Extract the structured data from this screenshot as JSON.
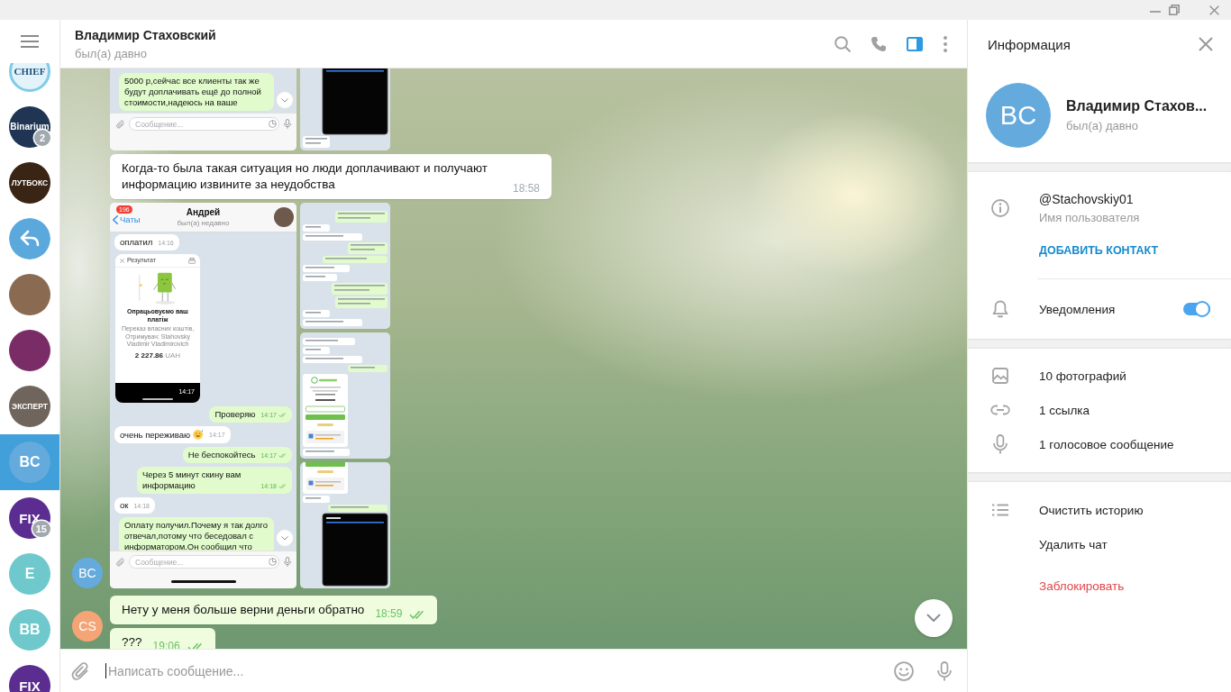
{
  "sidebar": {
    "chats": [
      {
        "kind": "logo",
        "text": "CHIEF",
        "color": "#e3f3fa",
        "selected": false
      },
      {
        "kind": "logo",
        "text": "Binarium",
        "color": "#1f3553",
        "badge": "2",
        "selected": false
      },
      {
        "kind": "logo",
        "text": "ЛУТБОКС",
        "color": "#3a2414",
        "selected": false
      },
      {
        "kind": "icon",
        "color": "#5ba8dd",
        "selected": false
      },
      {
        "kind": "photo",
        "color": "#8a6a50",
        "selected": false
      },
      {
        "kind": "photo",
        "color": "#7a2c66",
        "selected": false
      },
      {
        "kind": "logo",
        "text": "ЭКСПЕРТ",
        "color": "#6f655c",
        "selected": false
      },
      {
        "kind": "initials",
        "text": "BC",
        "color": "#65aadd",
        "selected": true
      },
      {
        "kind": "logo",
        "text": "FIX",
        "color": "#5b2d90",
        "badge": "15",
        "selected": false
      },
      {
        "kind": "initials",
        "text": "E",
        "color": "#6fc9cc",
        "selected": false
      },
      {
        "kind": "initials",
        "text": "BB",
        "color": "#6fc9cc",
        "selected": false
      },
      {
        "kind": "logo",
        "text": "FIX",
        "color": "#5b2d90",
        "selected": false
      }
    ]
  },
  "chat": {
    "title": "Владимир Стаховский",
    "status": "был(а) давно",
    "info_panel_open": true,
    "groups": [
      {
        "out": false,
        "avatar": {
          "text": "BC",
          "color": "#65aadd"
        },
        "messages": [
          {
            "kind": "album",
            "images": [
              {
                "kind": "screenshot",
                "items": [
                  {
                    "kind": "bubble",
                    "out": true,
                    "text": "5000 р,сейчас все клиенты так же будут доплачивать ещё до полной стоимости,надеюсь на ваше"
                  }
                ],
                "scroll_button": true,
                "composer": {
                  "placeholder": "Сообщение...",
                  "home_indicator": false
                }
              },
              {
                "kind": "thumbnail",
                "items": [
                  {
                    "kind": "dark_screen"
                  },
                  {
                    "kind": "long_bubble",
                    "out": false
                  }
                ]
              }
            ]
          },
          {
            "kind": "text",
            "text": "Когда-то была такая ситуация но люди доплачивают и получают информацию извините за неудобства",
            "time": "18:58"
          },
          {
            "kind": "album",
            "images": [
              {
                "kind": "screenshot",
                "header": {
                  "badge": "196",
                  "back": "Чаты",
                  "name": "Андрей",
                  "status": "был(а) недавно"
                },
                "items": [
                  {
                    "kind": "bubble",
                    "out": false,
                    "text": "оплатил",
                    "time": "14:16"
                  },
                  {
                    "kind": "receipt",
                    "title": "Результат",
                    "heading": "Опрацьовуємо ваш платіж",
                    "details": "Переказ власних коштів, Отримувач: Stahovsky Vladimir Vladimirovich",
                    "amount": "**2 227.86** UAH",
                    "time": "14:17"
                  },
                  {
                    "kind": "bubble",
                    "out": true,
                    "text": "Проверяю",
                    "time": "14:17",
                    "read": true
                  },
                  {
                    "kind": "bubble",
                    "out": false,
                    "text": "очень переживаю",
                    "emoji": true,
                    "time": "14:17"
                  },
                  {
                    "kind": "bubble",
                    "out": true,
                    "text": "Не беспокойтесь",
                    "time": "14:17",
                    "read": true
                  },
                  {
                    "kind": "bubble",
                    "out": true,
                    "text": "Через 5 минут скину вам информацию",
                    "time": "14:18",
                    "read": true
                  },
                  {
                    "kind": "bubble",
                    "out": false,
                    "text": "ок",
                    "time": "14:18"
                  },
                  {
                    "kind": "bubble",
                    "out": true,
                    "text": "Оплату получил.Почему я так долго отвечал,потому что беседовал с информатором.Он сообщил что"
                  }
                ],
                "scroll_button": true,
                "composer": {
                  "placeholder": "Сообщение...",
                  "home_indicator": true
                }
              },
              {
                "kind": "thumbnail",
                "items": [
                  {
                    "kind": "long_bubble",
                    "out": true
                  },
                  {
                    "kind": "bubble",
                    "out": false
                  },
                  {
                    "kind": "bubble",
                    "out": false
                  },
                  {
                    "kind": "long_bubble",
                    "out": true
                  },
                  {
                    "kind": "bubble",
                    "out": true
                  },
                  {
                    "kind": "bubble",
                    "out": false
                  },
                  {
                    "kind": "bubble",
                    "out": false
                  },
                  {
                    "kind": "long_bubble",
                    "out": true
                  },
                  {
                    "kind": "long_bubble",
                    "out": true
                  },
                  {
                    "kind": "bubble",
                    "out": false
                  },
                  {
                    "kind": "bubble",
                    "out": false
                  }
                ]
              },
              {
                "kind": "thumbnail",
                "items": [
                  {
                    "kind": "bubble",
                    "out": false
                  },
                  {
                    "kind": "bubble",
                    "out": false
                  },
                  {
                    "kind": "bubble",
                    "out": false
                  },
                  {
                    "kind": "bubble",
                    "out": true
                  },
                  {
                    "kind": "card"
                  },
                  {
                    "kind": "bubble",
                    "out": false
                  }
                ]
              },
              {
                "kind": "thumbnail",
                "items": [
                  {
                    "kind": "card"
                  },
                  {
                    "kind": "bubble",
                    "out": false
                  },
                  {
                    "kind": "bubble",
                    "out": true
                  },
                  {
                    "kind": "dark_screen"
                  }
                ]
              }
            ]
          }
        ]
      },
      {
        "out": true,
        "avatar": {
          "text": "CS",
          "color": "#f5a476"
        },
        "messages": [
          {
            "kind": "text",
            "text": "Нету у меня больше верни деньги обратно",
            "time": "18:59",
            "read": true
          },
          {
            "kind": "text",
            "text": "???",
            "time": "19:06",
            "read": true
          }
        ]
      }
    ],
    "composer": {
      "placeholder": "Написать сообщение...",
      "focused": true
    }
  },
  "info": {
    "title": "Информация",
    "avatar": {
      "text": "BC",
      "color": "#65aadd"
    },
    "name": "Владимир Стахов...",
    "status": "был(а) давно",
    "username": "@Stachovskiy01",
    "username_label": "Имя пользователя",
    "add_contact": "ДОБАВИТЬ КОНТАКТ",
    "notifications": {
      "label": "Уведомления",
      "on": true
    },
    "media": [
      {
        "kind": "photos",
        "label": "10 фотографий"
      },
      {
        "kind": "links",
        "label": "1 ссылка"
      },
      {
        "kind": "voice",
        "label": "1 голосовое сообщение"
      }
    ],
    "actions": [
      {
        "kind": "clear",
        "label": "Очистить историю"
      },
      {
        "kind": "delete",
        "label": "Удалить чат"
      },
      {
        "kind": "block",
        "label": "Заблокировать"
      }
    ]
  }
}
